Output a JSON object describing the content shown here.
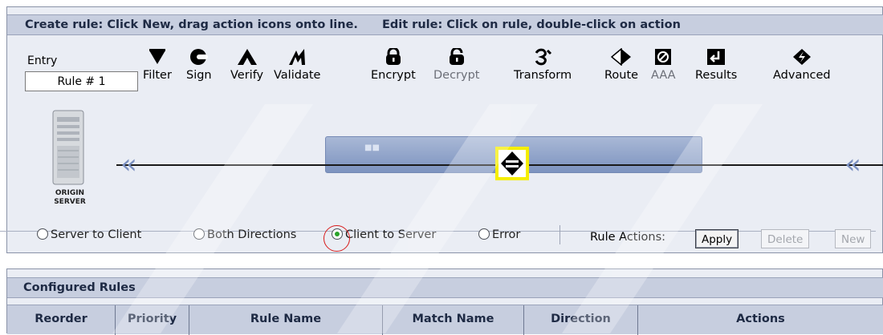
{
  "editor": {
    "header_create": "Create rule: Click New, drag action icons onto line.",
    "header_edit": "Edit rule: Click on rule, double-click on action",
    "entry_label": "Entry",
    "rule_name_value": "Rule # 1",
    "tools": [
      {
        "id": "filter",
        "label": "Filter",
        "icon": "filter-icon",
        "enabled": true
      },
      {
        "id": "sign",
        "label": "Sign",
        "icon": "sign-icon",
        "enabled": true
      },
      {
        "id": "verify",
        "label": "Verify",
        "icon": "verify-icon",
        "enabled": true
      },
      {
        "id": "validate",
        "label": "Validate",
        "icon": "validate-icon",
        "enabled": true
      },
      {
        "id": "encrypt",
        "label": "Encrypt",
        "icon": "encrypt-icon",
        "enabled": true
      },
      {
        "id": "decrypt",
        "label": "Decrypt",
        "icon": "decrypt-icon",
        "enabled": false
      },
      {
        "id": "transform",
        "label": "Transform",
        "icon": "transform-icon",
        "enabled": true
      },
      {
        "id": "route",
        "label": "Route",
        "icon": "route-icon",
        "enabled": true
      },
      {
        "id": "aaa",
        "label": "AAA",
        "icon": "aaa-icon",
        "enabled": false
      },
      {
        "id": "results",
        "label": "Results",
        "icon": "results-icon",
        "enabled": true
      },
      {
        "id": "advanced",
        "label": "Advanced",
        "icon": "advanced-icon",
        "enabled": true
      }
    ],
    "server_label_line1": "ORIGIN",
    "server_label_line2": "SERVER",
    "directions": [
      {
        "label": "Server to Client",
        "selected": false
      },
      {
        "label": "Both Directions",
        "selected": false
      },
      {
        "label": "Client to Server",
        "selected": true
      },
      {
        "label": "Error",
        "selected": false
      }
    ],
    "rule_actions_label": "Rule Actions:",
    "buttons": {
      "apply": "Apply",
      "delete": "Delete",
      "new": "New"
    }
  },
  "rules": {
    "title": "Configured Rules",
    "columns": [
      "Reorder",
      "Priority",
      "Rule Name",
      "Match Name",
      "Direction",
      "Actions"
    ]
  },
  "colors": {
    "header_bg": "#c7cedf",
    "panel_bg": "#eaedf4",
    "highlight_box": "#f5ee00",
    "selected_radio": "#2aa32a",
    "annotation_circle": "#d81c1c"
  }
}
